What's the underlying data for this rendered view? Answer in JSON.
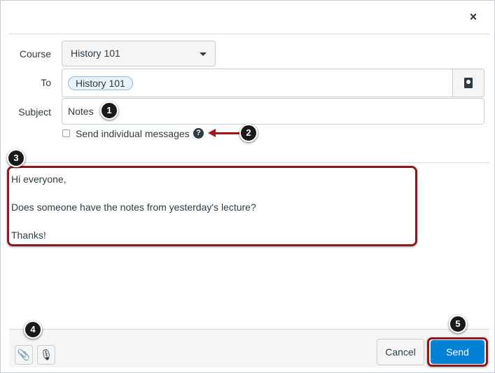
{
  "dialog": {
    "close_glyph": "×",
    "close_icon": "close-icon"
  },
  "form": {
    "course_label": "Course",
    "course_value": "History 101",
    "to_label": "To",
    "to_recipient": "History 101",
    "address_book_icon": "address-book-icon",
    "subject_label": "Subject",
    "subject_value": "Notes",
    "individual_label": "Send individual messages",
    "individual_checked": false,
    "help_glyph": "?"
  },
  "message": {
    "lines": [
      "Hi everyone,",
      "",
      "Does someone have the notes from yesterday's lecture?",
      "",
      "Thanks!"
    ]
  },
  "footer": {
    "attach_icon": "paperclip-icon",
    "media_icon": "record-media-icon",
    "attach_glyph": "📎",
    "media_glyph": "🎙",
    "cancel_label": "Cancel",
    "send_label": "Send"
  },
  "markers": [
    "1",
    "2",
    "3",
    "4",
    "5"
  ],
  "colors": {
    "accent": "#0081d6",
    "highlight": "#8b1a1e",
    "arrow": "#a5161a"
  }
}
